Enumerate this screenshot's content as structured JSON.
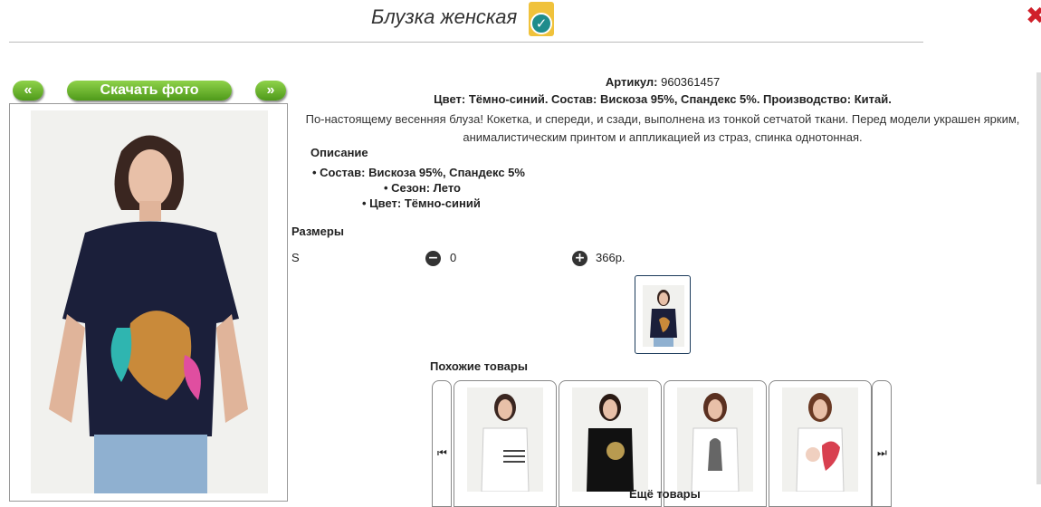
{
  "header": {
    "title": "Блузка женская",
    "close_icon": "close-icon",
    "verified_icon": "check-badge-icon"
  },
  "gallery": {
    "prev_label": "«",
    "download_label": "Скачать фото",
    "next_label": "»",
    "photo": "model-in-navy-blouse-with-leopard-print"
  },
  "product": {
    "article_label": "Артикул:",
    "article_value": "960361457",
    "color_line": "Цвет: Тёмно-синий. Состав: Вискоза 95%, Спандекс 5%. Производство: Китай.",
    "description": "По-настоящему весенняя блуза! Кокетка, и спереди, и сзади, выполнена из тонкой сетчатой ткани. Перед модели украшен ярким, анималистическим принтом и аппликацией из страз, спинка однотонная.",
    "desc_heading": "Описание",
    "specs": [
      "Состав: Вискоза 95%, Спандекс 5%",
      "Сезон: Лето",
      "Цвет: Тёмно-синий"
    ]
  },
  "sizes": {
    "heading": "Размеры",
    "rows": [
      {
        "size": "S",
        "qty": "0",
        "price": "366р."
      }
    ]
  },
  "similar": {
    "heading": "Похожие товары",
    "more_label": "Ещё товары",
    "items": [
      "white-striped-tee",
      "black-print-tee",
      "white-print-tee",
      "white-heart-tee"
    ]
  },
  "colors": {
    "button_green": "#5aab22",
    "close_red": "#d0202a",
    "badge_yellow": "#f0c23b"
  }
}
